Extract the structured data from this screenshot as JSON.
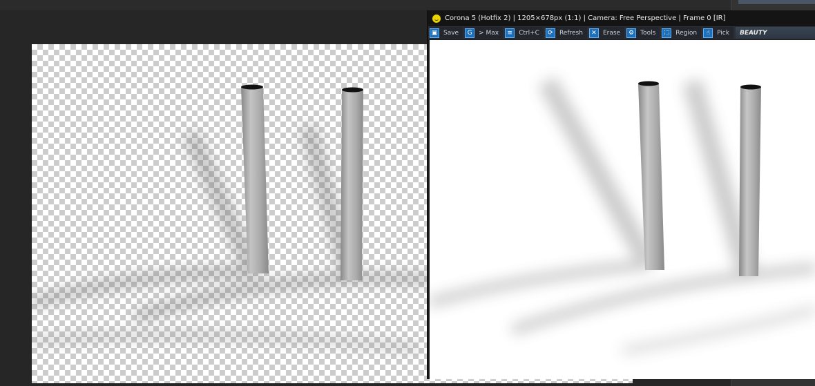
{
  "render_window": {
    "title": "Corona 5 (Hotfix 2) | 1205×678px (1:1) | Camera: Free Perspective | Frame 0 [IR]",
    "toolbar": [
      {
        "label": "Save",
        "icon": "save-icon",
        "glyph": "▣"
      },
      {
        "label": "> Max",
        "icon": "max-icon",
        "glyph": "G"
      },
      {
        "label": "Ctrl+C",
        "icon": "copy-icon",
        "glyph": "≡"
      },
      {
        "label": "Refresh",
        "icon": "refresh-icon",
        "glyph": "⟳"
      },
      {
        "label": "Erase",
        "icon": "erase-icon",
        "glyph": "✕"
      },
      {
        "label": "Tools",
        "icon": "gear-icon",
        "glyph": "⚙"
      },
      {
        "label": "Region",
        "icon": "region-icon",
        "glyph": "⬚"
      },
      {
        "label": "Pick",
        "icon": "pick-icon",
        "glyph": "☝"
      }
    ],
    "render_pass": "BEAUTY"
  }
}
